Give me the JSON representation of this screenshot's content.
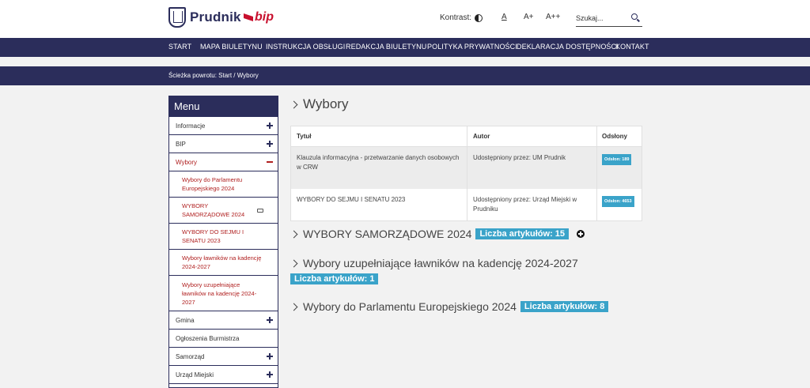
{
  "header": {
    "logo_text": "Prudnik",
    "bip_text": "bip",
    "contrast_label": "Kontrast:",
    "font_small": "A",
    "font_medium": "A+",
    "font_large": "A++",
    "search_placeholder": "Szukaj..."
  },
  "nav": [
    "START",
    "MAPA BIULETYNU",
    "INSTRUKCJA OBSŁUGI",
    "REDAKCJA BIULETYNU",
    "POLITYKA PRYWATNOŚCI",
    "DEKLARACJA DOSTĘPNOŚCI",
    "KONTAKT"
  ],
  "breadcrumb": "Ścieżka powrotu: Start  /  Wybory",
  "sidebar": {
    "title": "Menu",
    "items": [
      {
        "label": "Informacje"
      },
      {
        "label": "BIP"
      },
      {
        "label": "Wybory"
      },
      {
        "label": "Wybory do Parlamentu Europejskiego 2024"
      },
      {
        "label": "WYBORY SAMORZĄDOWE 2024"
      },
      {
        "label": "WYBORY DO SEJMU I SENATU 2023"
      },
      {
        "label": "Wybory ławników na kadencję 2024-2027"
      },
      {
        "label": "Wybory uzupełniające ławników na kadencję 2024-2027"
      },
      {
        "label": "Gmina"
      },
      {
        "label": "Ogłoszenia Burmistrza"
      },
      {
        "label": "Samorząd"
      },
      {
        "label": "Urząd Miejski"
      }
    ]
  },
  "main": {
    "title": "Wybory",
    "table": {
      "headers": [
        "Tytuł",
        "Autor",
        "Odsłony"
      ],
      "rows": [
        {
          "title": "Klauzula informacyjna - przetwarzanie danych osobowych w CRW",
          "author": "Udostępniony przez: UM Prudnik",
          "views": "Odsłon: 189"
        },
        {
          "title": "WYBORY DO SEJMU I SENATU 2023",
          "author": "Udostępniony przez: Urząd Miejski w Prudniku",
          "views": "Odsłon: 4653"
        }
      ]
    },
    "sections": [
      {
        "title": "WYBORY SAMORZĄDOWE 2024",
        "count": "Liczba artykułów: 15"
      },
      {
        "title": "Wybory uzupełniające ławników na kadencję 2024-2027",
        "count": "Liczba artykułów: 1"
      },
      {
        "title": "Wybory do Parlamentu Europejskiego 2024",
        "count": "Liczba artykułów: 8"
      }
    ]
  },
  "colors": {
    "navy": "#2b2d5b",
    "accent_red": "#c8102e",
    "badge_blue": "#3aa3c9"
  }
}
